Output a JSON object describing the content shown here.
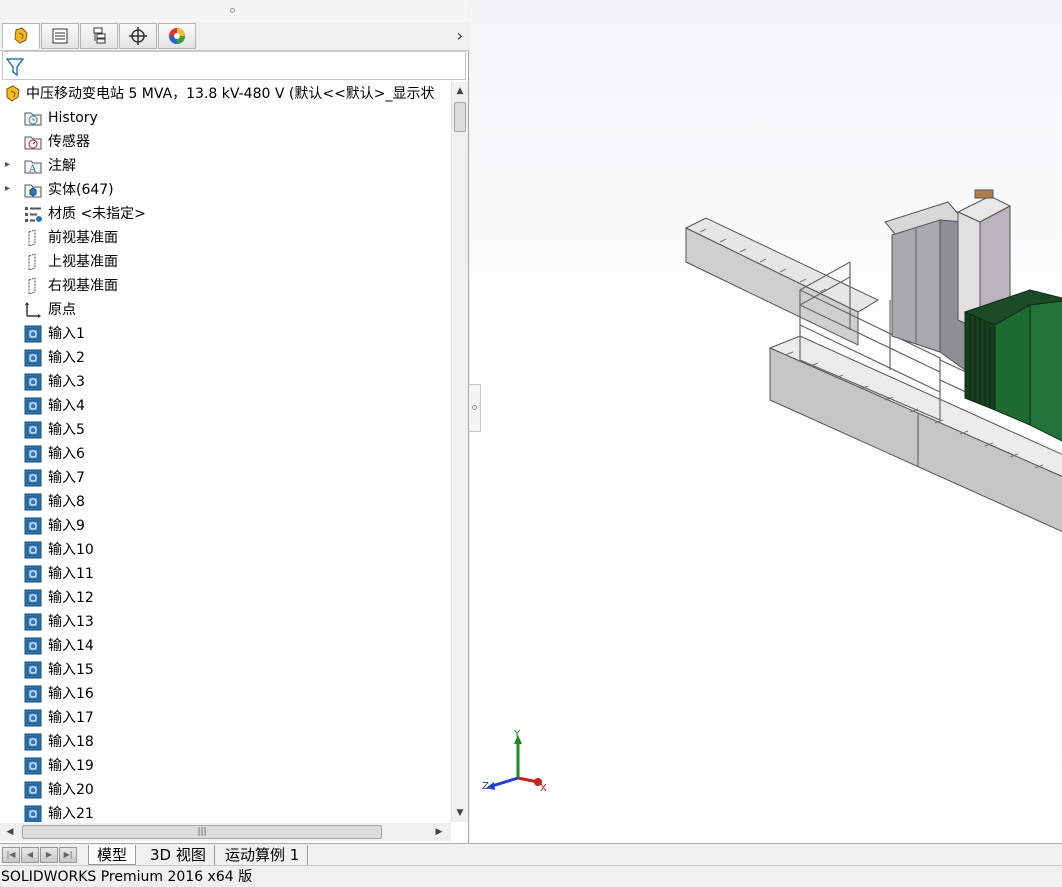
{
  "feature_tree": {
    "root_label": "中压移动变电站 5 MVA，13.8 kV-480 V  (默认<<默认>_显示状",
    "items": [
      {
        "label": "History",
        "icon": "history-folder-icon",
        "expandable": false
      },
      {
        "label": "传感器",
        "icon": "sensor-folder-icon",
        "expandable": false
      },
      {
        "label": "注解",
        "icon": "annotations-folder-icon",
        "expandable": true
      },
      {
        "label": "实体(647)",
        "icon": "solid-bodies-folder-icon",
        "expandable": true
      },
      {
        "label": "材质 <未指定>",
        "icon": "material-icon",
        "expandable": false
      },
      {
        "label": "前视基准面",
        "icon": "plane-icon",
        "expandable": false
      },
      {
        "label": "上视基准面",
        "icon": "plane-icon",
        "expandable": false
      },
      {
        "label": "右视基准面",
        "icon": "plane-icon",
        "expandable": false
      },
      {
        "label": "原点",
        "icon": "origin-icon",
        "expandable": false
      },
      {
        "label": "输入1",
        "icon": "imported-body-icon",
        "expandable": false
      },
      {
        "label": "输入2",
        "icon": "imported-body-icon",
        "expandable": false
      },
      {
        "label": "输入3",
        "icon": "imported-body-icon",
        "expandable": false
      },
      {
        "label": "输入4",
        "icon": "imported-body-icon",
        "expandable": false
      },
      {
        "label": "输入5",
        "icon": "imported-body-icon",
        "expandable": false
      },
      {
        "label": "输入6",
        "icon": "imported-body-icon",
        "expandable": false
      },
      {
        "label": "输入7",
        "icon": "imported-body-icon",
        "expandable": false
      },
      {
        "label": "输入8",
        "icon": "imported-body-icon",
        "expandable": false
      },
      {
        "label": "输入9",
        "icon": "imported-body-icon",
        "expandable": false
      },
      {
        "label": "输入10",
        "icon": "imported-body-icon",
        "expandable": false
      },
      {
        "label": "输入11",
        "icon": "imported-body-icon",
        "expandable": false
      },
      {
        "label": "输入12",
        "icon": "imported-body-icon",
        "expandable": false
      },
      {
        "label": "输入13",
        "icon": "imported-body-icon",
        "expandable": false
      },
      {
        "label": "输入14",
        "icon": "imported-body-icon",
        "expandable": false
      },
      {
        "label": "输入15",
        "icon": "imported-body-icon",
        "expandable": false
      },
      {
        "label": "输入16",
        "icon": "imported-body-icon",
        "expandable": false
      },
      {
        "label": "输入17",
        "icon": "imported-body-icon",
        "expandable": false
      },
      {
        "label": "输入18",
        "icon": "imported-body-icon",
        "expandable": false
      },
      {
        "label": "输入19",
        "icon": "imported-body-icon",
        "expandable": false
      },
      {
        "label": "输入20",
        "icon": "imported-body-icon",
        "expandable": false
      },
      {
        "label": "输入21",
        "icon": "imported-body-icon",
        "expandable": false
      }
    ]
  },
  "bottom_tabs": [
    "模型",
    "3D 视图",
    "运动算例 1"
  ],
  "status_bar": {
    "text": "SOLIDWORKS Premium 2016 x64 版"
  },
  "triad": {
    "x": "X",
    "y": "Y",
    "z": "Z"
  },
  "colors": {
    "accent_blue": "#2a78b8",
    "equipment_green": "#1e6b32",
    "grey_body": "#c8c8c8"
  }
}
